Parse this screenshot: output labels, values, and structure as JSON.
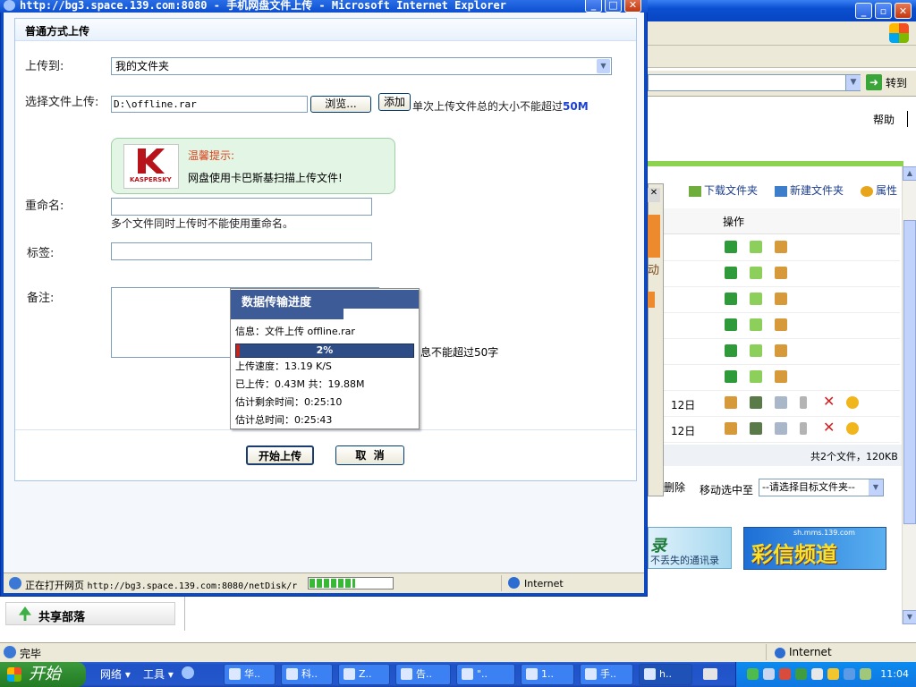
{
  "background_window": {
    "go_label": "转到",
    "help_link": "帮助",
    "toolbar_links": [
      "下载文件夹",
      "新建文件夹",
      "属性"
    ],
    "column_header": "操作",
    "dates": [
      "12日",
      "12日"
    ],
    "total_text": "共2个文件，120KB",
    "delete_label": "删除",
    "move_label": "移动选中至",
    "move_select": "--请选择目标文件夹--",
    "partial_text": "动",
    "ad1_title": "录",
    "ad1_sub": "不丢失的通讯录",
    "ad2_url": "sh.mms.139.com",
    "ad2_title": "彩信频道",
    "share_panel": "共享部落",
    "status_text": "完毕",
    "status_zone": "Internet"
  },
  "popup": {
    "title": "http://bg3.space.139.com:8080 - 手机网盘文件上传 - Microsoft Internet Explorer",
    "form_title": "普通方式上传",
    "upload_to_label": "上传到:",
    "upload_to_value": "我的文件夹",
    "choose_file_label": "选择文件上传:",
    "file_path": "D:\\offline.rar",
    "browse_label": "浏览...",
    "add_label": "添加",
    "size_limit_text": "单次上传文件总的大小不能超过",
    "size_limit_value": "50M",
    "tip_title": "温馨提示:",
    "tip_body": "网盘使用卡巴斯基扫描上传文件!",
    "kaspersky_wordmark": "KASPERSKY",
    "rename_label": "重命名:",
    "rename_note": "多个文件同时上传时不能使用重命名。",
    "tag_label": "标签:",
    "note_label": "备注:",
    "note_limit": "息不能超过50字",
    "start_button": "开始上传",
    "cancel_button": "取  消",
    "status_text": "正在打开网页",
    "status_url": "http://bg3.space.139.com:8080/netDisk/r",
    "status_progress": 0.55,
    "status_zone": "Internet"
  },
  "progress_dialog": {
    "title": "数据传输进度",
    "info": "信息：文件上传 offline.rar",
    "percent_label": "2%",
    "percent": 0.02,
    "speed": "上传速度：13.19 K/S",
    "uploaded": "已上传：0.43M 共：19.88M",
    "remaining": "估计剩余时间：0:25:10",
    "total_time": "估计总时间：0:25:43"
  },
  "taskbar": {
    "start_label": "开始",
    "quick": [
      "网络",
      "工具"
    ],
    "tasks": [
      "华..",
      "科..",
      "Z..",
      "告..",
      "\"..",
      "1..",
      "手..",
      "h.."
    ],
    "active_task": 7,
    "clock": "11:04"
  },
  "colors": {
    "title_blue": "#0a4fd0",
    "progress_red": "#c0261d",
    "dialog_header": "#3d5b96",
    "tip_green_bg": "#e3f5e5",
    "tip_title": "#d8431b"
  }
}
